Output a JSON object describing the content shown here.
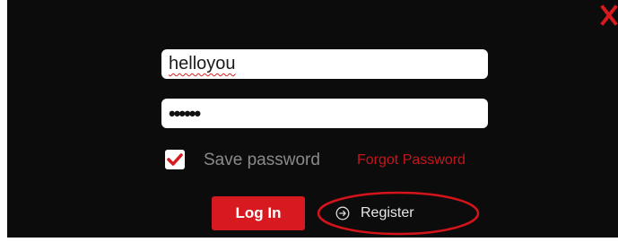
{
  "dialog": {
    "close_icon": "close-icon",
    "accent_color": "#d71920"
  },
  "username": {
    "value": "helloyou"
  },
  "password": {
    "masked_value": "••••••"
  },
  "save_password": {
    "checked": true,
    "label": "Save password"
  },
  "forgot_password": {
    "label": "Forgot Password"
  },
  "login_button": {
    "label": "Log In"
  },
  "register_button": {
    "label": "Register",
    "icon": "circle-arrow-icon"
  },
  "annotation": {
    "shape": "red ellipse around Register"
  }
}
